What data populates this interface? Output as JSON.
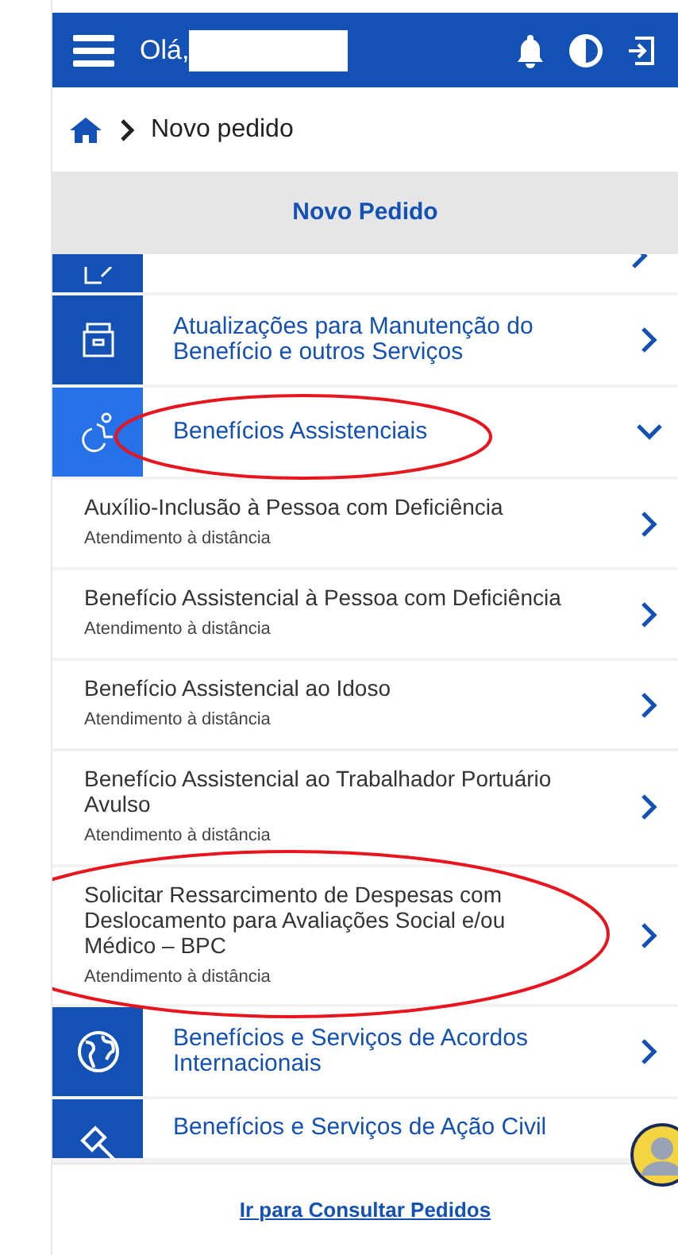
{
  "header": {
    "greeting": "Olá,"
  },
  "breadcrumb": {
    "current": "Novo pedido"
  },
  "section_title": "Novo Pedido",
  "categories": [
    {
      "title": "Atualizações para Manutenção do Benefício e outros Serviços",
      "expanded": false
    },
    {
      "title": "Benefícios Assistenciais",
      "expanded": true,
      "children": [
        {
          "title": "Auxílio-Inclusão à Pessoa com Deficiência",
          "subtitle": "Atendimento à distância"
        },
        {
          "title": "Benefício Assistencial à Pessoa com Deficiência",
          "subtitle": "Atendimento à distância"
        },
        {
          "title": "Benefício Assistencial ao Idoso",
          "subtitle": "Atendimento à distância"
        },
        {
          "title": "Benefício Assistencial ao Trabalhador Portuário Avulso",
          "subtitle": "Atendimento à distância"
        },
        {
          "title": "Solicitar Ressarcimento de Despesas com Deslocamento para Avaliações Social e/ou Médico – BPC",
          "subtitle": "Atendimento à distância"
        }
      ]
    },
    {
      "title": "Benefícios e Serviços de Acordos Internacionais",
      "expanded": false
    },
    {
      "title": "Benefícios e Serviços de Ação Civil",
      "expanded": false
    }
  ],
  "footer_link": "Ir para Consultar Pedidos"
}
